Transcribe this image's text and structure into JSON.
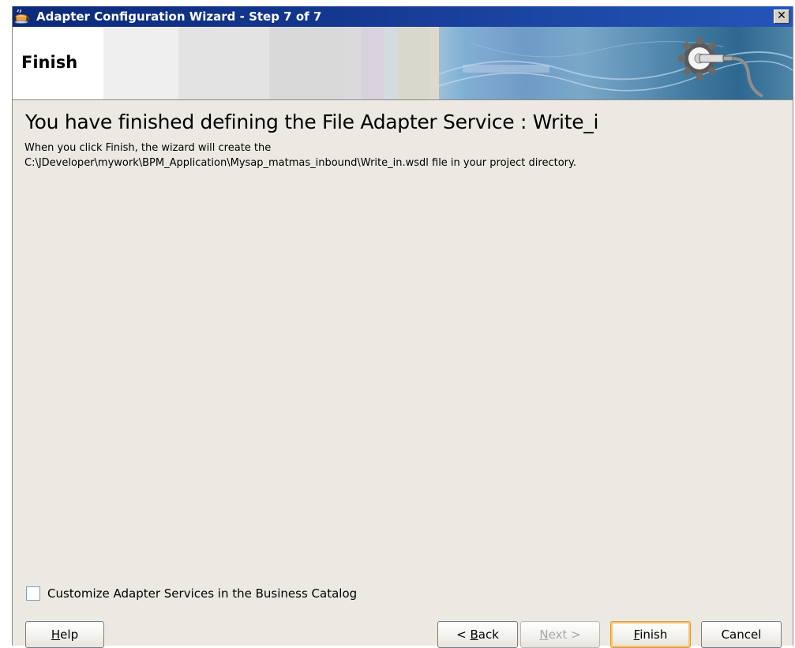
{
  "window": {
    "title": "Adapter Configuration Wizard - Step 7 of 7",
    "close_glyph": "✕"
  },
  "banner": {
    "title": "Finish"
  },
  "main": {
    "heading": "You have finished defining the File Adapter Service : Write_i",
    "description_line1": "When you click Finish, the wizard will create the",
    "description_line2": "C:\\JDeveloper\\mywork\\BPM_Application\\Mysap_matmas_inbound\\Write_in.wsdl file in your project directory."
  },
  "options": {
    "customize_label": "Customize Adapter Services in the Business Catalog",
    "customize_checked": false
  },
  "buttons": {
    "help": {
      "pre": "",
      "mnemonic": "H",
      "post": "elp"
    },
    "back": {
      "pre": "< ",
      "mnemonic": "B",
      "post": "ack"
    },
    "next": {
      "pre": "",
      "mnemonic": "N",
      "post": "ext >"
    },
    "finish": {
      "pre": "",
      "mnemonic": "F",
      "post": "inish"
    },
    "cancel": {
      "pre": "Cancel",
      "mnemonic": "",
      "post": ""
    }
  },
  "icons": {
    "app_icon": "coffee-cup-icon",
    "banner_graphic": "gear-plug-icon"
  }
}
